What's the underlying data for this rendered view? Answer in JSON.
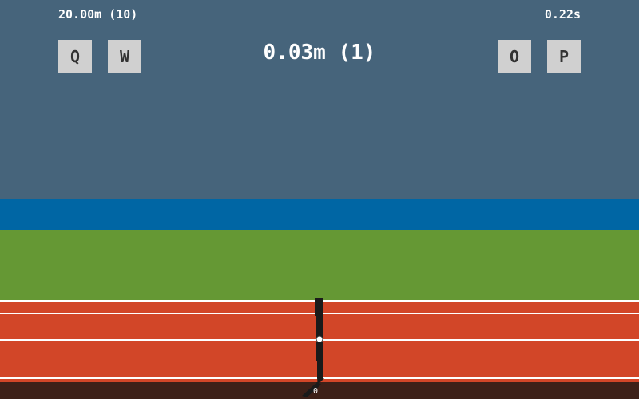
{
  "hud": {
    "best_score": "20.00m (10)",
    "timer": "0.22s",
    "current_distance": "0.03m (1)"
  },
  "controls": {
    "q_label": "Q",
    "w_label": "W",
    "o_label": "O",
    "p_label": "P"
  },
  "track": {
    "distance_marker": "0"
  },
  "colors": {
    "sky": "#46647b",
    "water": "#0066a4",
    "grass": "#659834",
    "track": "#d24628",
    "ground": "#3d2018",
    "button": "#d0d0d0",
    "runner": "#1a1a1a"
  }
}
